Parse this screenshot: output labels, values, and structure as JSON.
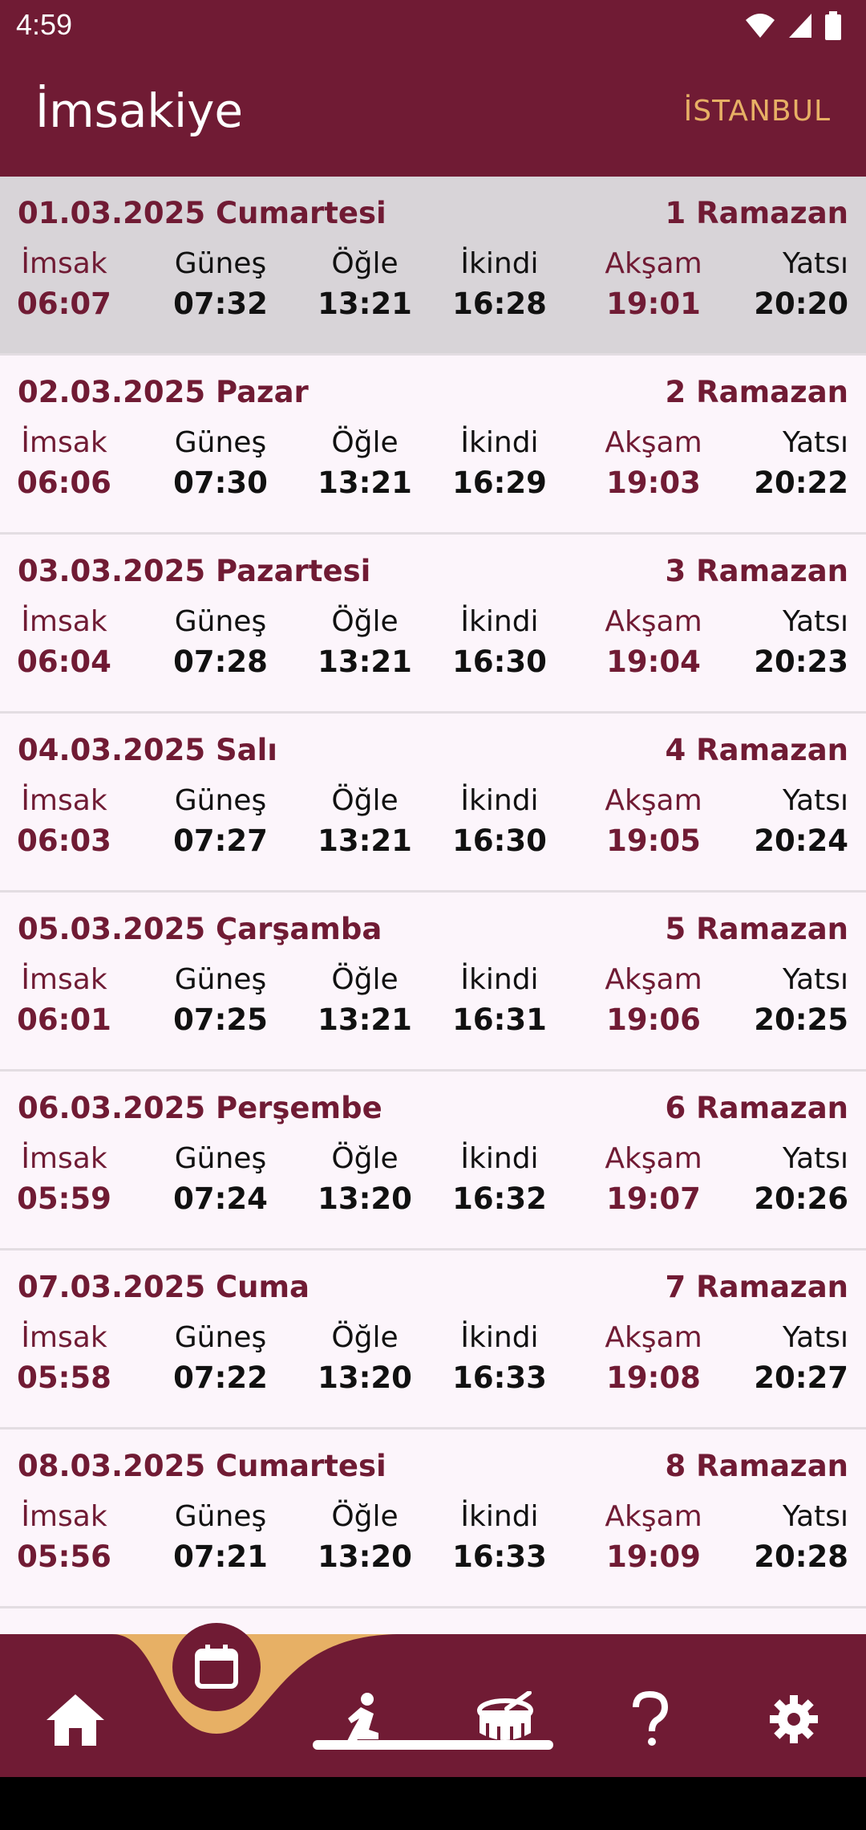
{
  "status_bar": {
    "time": "4:59"
  },
  "app_bar": {
    "title": "İmsakiye",
    "city": "İSTANBUL"
  },
  "colors": {
    "primary": "#701b34",
    "accent": "#e7b065",
    "today_bg": "#d8d4d8"
  },
  "time_labels": [
    "İmsak",
    "Güneş",
    "Öğle",
    "İkindi",
    "Akşam",
    "Yatsı"
  ],
  "days": [
    {
      "date": "01.03.2025 Cumartesi",
      "hijri": "1 Ramazan",
      "times": [
        "06:07",
        "07:32",
        "13:21",
        "16:28",
        "19:01",
        "20:20"
      ]
    },
    {
      "date": "02.03.2025 Pazar",
      "hijri": "2 Ramazan",
      "times": [
        "06:06",
        "07:30",
        "13:21",
        "16:29",
        "19:03",
        "20:22"
      ]
    },
    {
      "date": "03.03.2025 Pazartesi",
      "hijri": "3 Ramazan",
      "times": [
        "06:04",
        "07:28",
        "13:21",
        "16:30",
        "19:04",
        "20:23"
      ]
    },
    {
      "date": "04.03.2025 Salı",
      "hijri": "4 Ramazan",
      "times": [
        "06:03",
        "07:27",
        "13:21",
        "16:30",
        "19:05",
        "20:24"
      ]
    },
    {
      "date": "05.03.2025 Çarşamba",
      "hijri": "5 Ramazan",
      "times": [
        "06:01",
        "07:25",
        "13:21",
        "16:31",
        "19:06",
        "20:25"
      ]
    },
    {
      "date": "06.03.2025 Perşembe",
      "hijri": "6 Ramazan",
      "times": [
        "05:59",
        "07:24",
        "13:20",
        "16:32",
        "19:07",
        "20:26"
      ]
    },
    {
      "date": "07.03.2025 Cuma",
      "hijri": "7 Ramazan",
      "times": [
        "05:58",
        "07:22",
        "13:20",
        "16:33",
        "19:08",
        "20:27"
      ]
    },
    {
      "date": "08.03.2025 Cumartesi",
      "hijri": "8 Ramazan",
      "times": [
        "05:56",
        "07:21",
        "13:20",
        "16:33",
        "19:09",
        "20:28"
      ]
    }
  ],
  "bottom_nav": {
    "icons": [
      "home-icon",
      "calendar-icon",
      "prayer-icon",
      "drum-icon",
      "help-icon",
      "settings-icon"
    ],
    "active": "calendar-icon"
  }
}
